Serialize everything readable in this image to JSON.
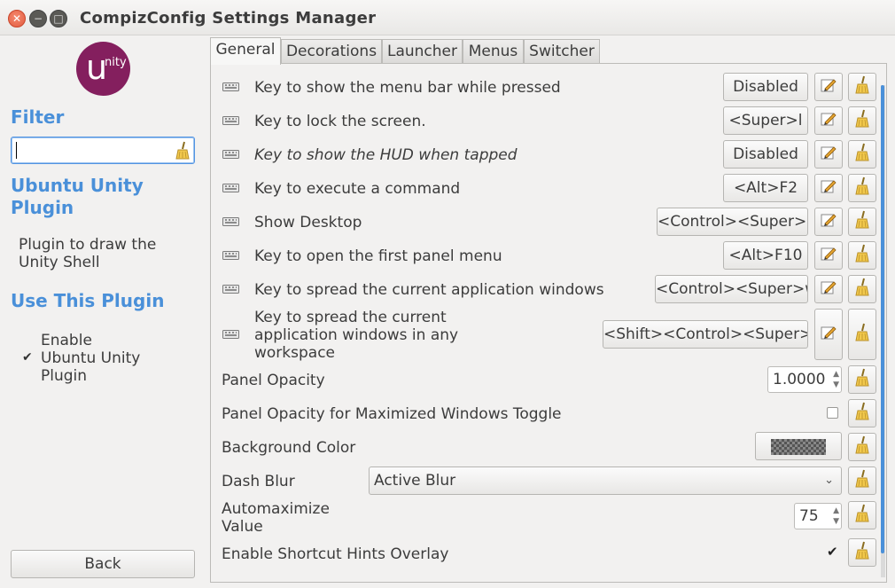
{
  "window": {
    "title": "CompizConfig Settings Manager"
  },
  "sidebar": {
    "logo_main": "u",
    "logo_suffix": "nity",
    "filter_heading": "Filter",
    "filter_value": "",
    "plugin_heading": [
      "Ubuntu Unity",
      "Plugin"
    ],
    "plugin_description": [
      "Plugin to draw the",
      "Unity Shell"
    ],
    "use_heading": "Use This Plugin",
    "enable_label": [
      "Enable",
      "Ubuntu Unity",
      "Plugin"
    ],
    "enable_checked": true,
    "back_label": "Back"
  },
  "tabs": [
    {
      "label": "General",
      "active": true
    },
    {
      "label": "Decorations",
      "active": false
    },
    {
      "label": "Launcher",
      "active": false
    },
    {
      "label": "Menus",
      "active": false
    },
    {
      "label": "Switcher",
      "active": false
    }
  ],
  "keybindings": [
    {
      "label": "Key to show the menu bar while pressed",
      "value": "Disabled",
      "italic": false
    },
    {
      "label": "Key to lock the screen.",
      "value": "<Super>l",
      "italic": false
    },
    {
      "label": "Key to show the HUD when tapped",
      "value": "Disabled",
      "italic": true
    },
    {
      "label": "Key to execute a command",
      "value": "<Alt>F2",
      "italic": false
    },
    {
      "label": "Show Desktop",
      "value": "<Control><Super>d",
      "italic": false
    },
    {
      "label": "Key to open the first panel menu",
      "value": "<Alt>F10",
      "italic": false
    },
    {
      "label": "Key to spread the current application windows",
      "value": "<Control><Super>w",
      "italic": false
    },
    {
      "label": [
        "Key to spread the current",
        "application windows in any",
        "workspace"
      ],
      "value": "<Shift><Control><Super>w",
      "italic": false
    }
  ],
  "settings": {
    "panel_opacity": {
      "label": "Panel Opacity",
      "value": "1.0000"
    },
    "panel_opacity_max_toggle": {
      "label": "Panel Opacity for Maximized Windows Toggle",
      "checked": false
    },
    "background_color": {
      "label": "Background Color"
    },
    "dash_blur": {
      "label": "Dash Blur",
      "value": "Active Blur"
    },
    "automaximize": {
      "label": [
        "Automaximize",
        "Value"
      ],
      "value": "75"
    },
    "shortcut_hints": {
      "label": "Enable Shortcut Hints Overlay",
      "checked": true
    }
  },
  "colors": {
    "accent": "#4a90d9",
    "logo": "#841f5e",
    "close": "#e25b3e"
  }
}
